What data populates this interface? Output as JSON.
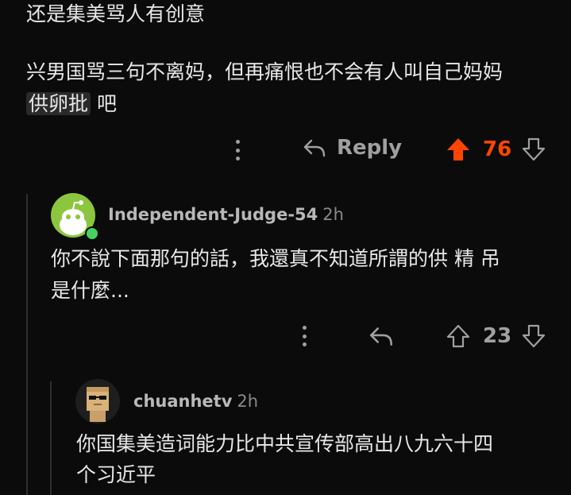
{
  "top_comment": {
    "line1": "还是集美骂人有创意",
    "line2": "兴男国骂三句不离妈，但再痛恨也不会有人叫自己妈妈",
    "line3_spoiler": "供卵批",
    "line3_rest": " 吧",
    "actions": {
      "reply_label": "Reply",
      "vote_count": "76",
      "upvoted": true,
      "upvote_color": "#ff4500"
    }
  },
  "reply1": {
    "username": "Independent-Judge-54",
    "time": "2h",
    "avatar_color": "#8cc63f",
    "online_color": "#46d160",
    "line1": "你不說下面那句的話，我還真不知道所謂的供 精 吊",
    "line2": "是什麼...",
    "actions": {
      "vote_count": "23"
    }
  },
  "reply2": {
    "username": "chuanhetv",
    "time": "2h",
    "line1": "你国集美造词能力比中共宣传部高出八九六十四",
    "line2": "个习近平"
  }
}
